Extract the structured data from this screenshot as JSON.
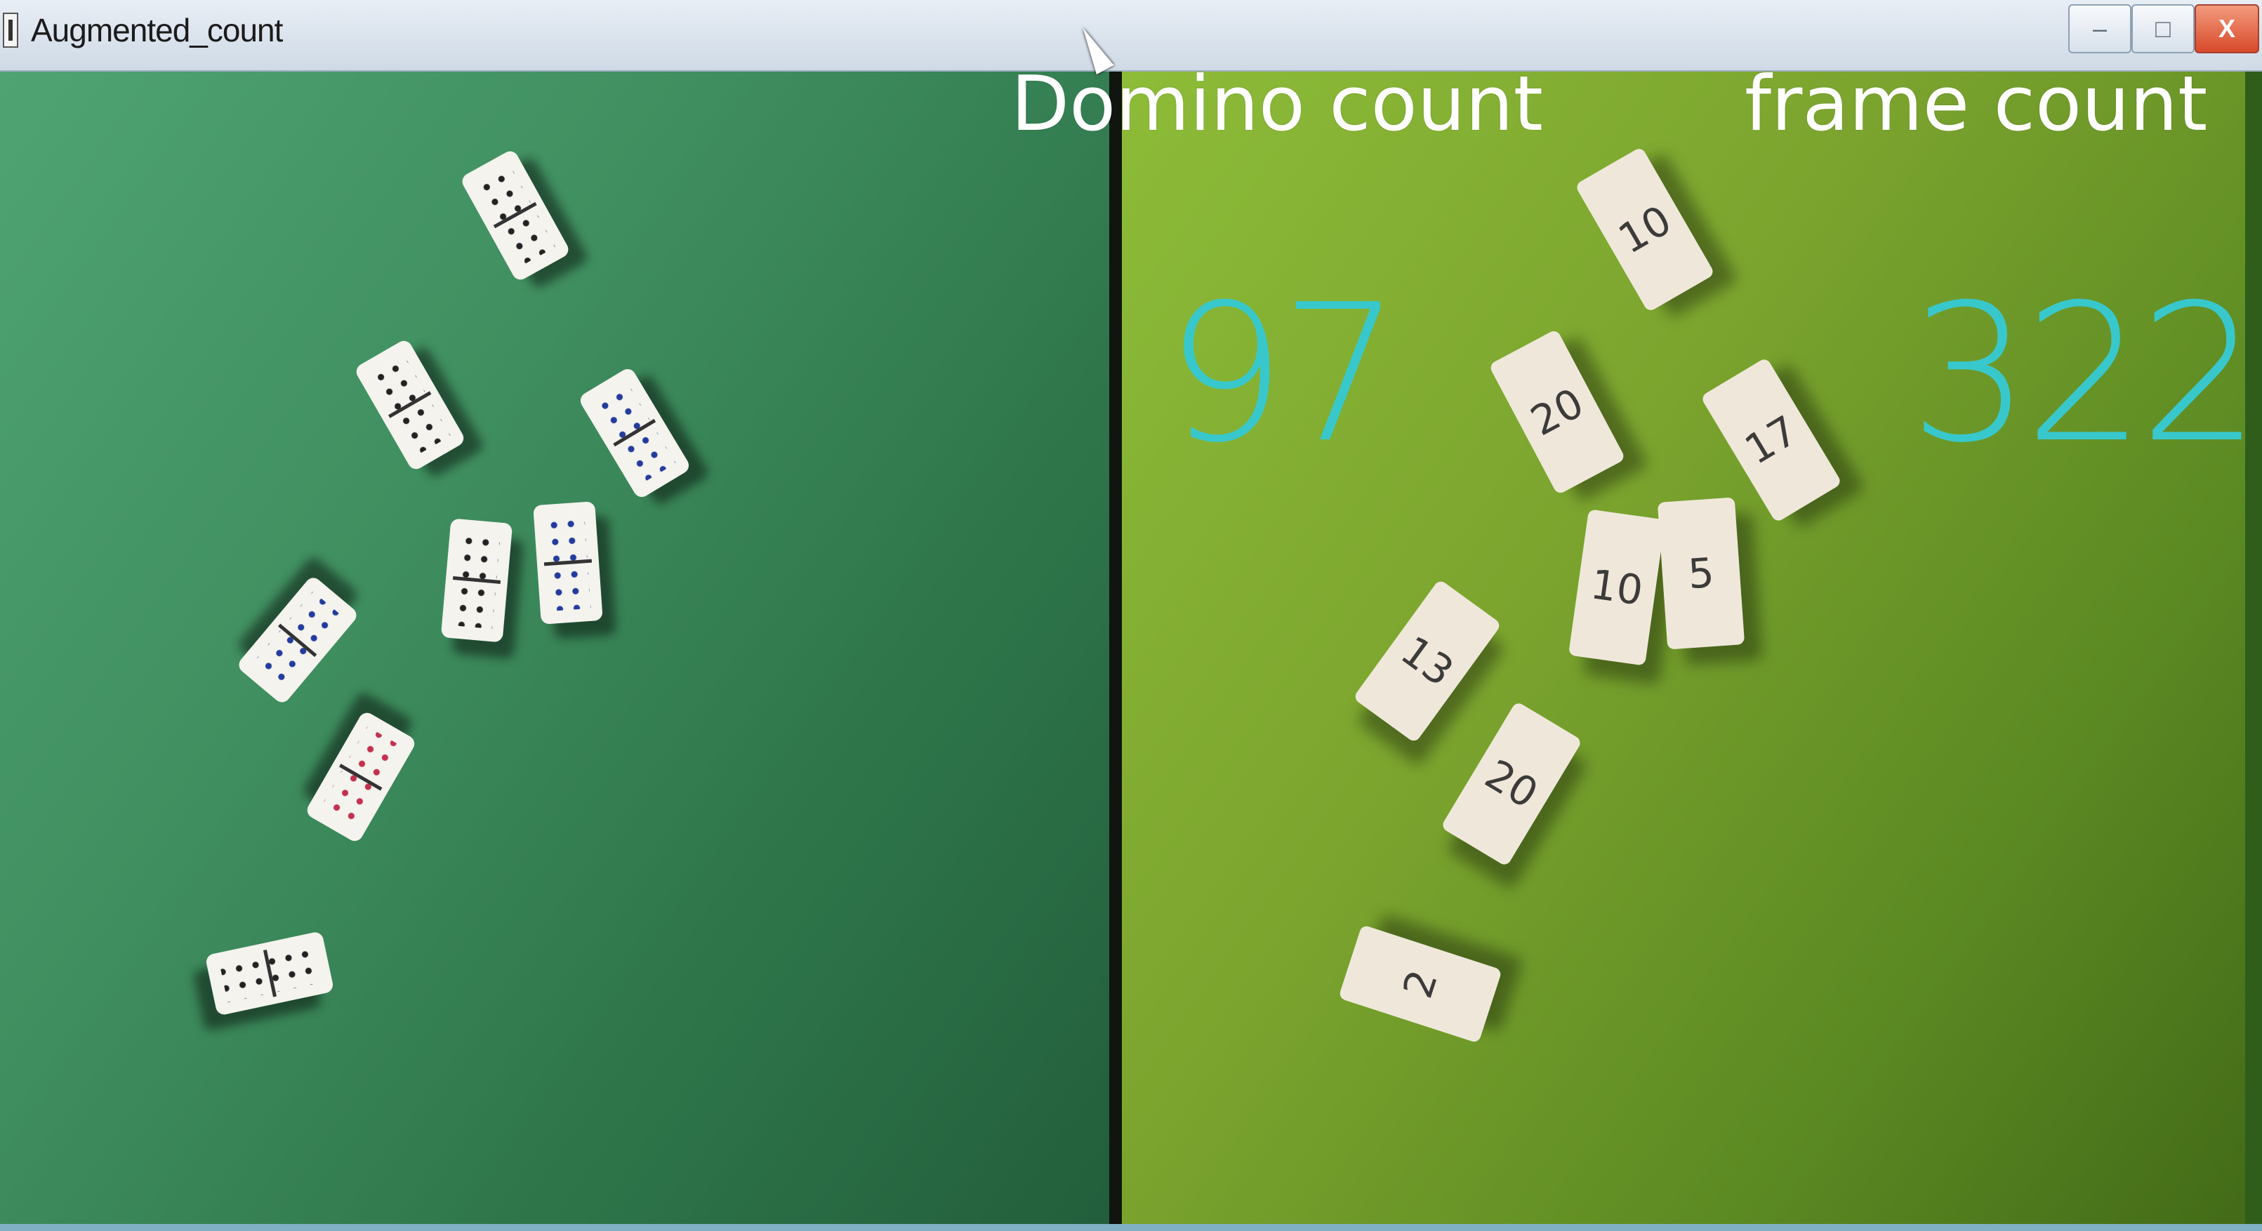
{
  "window": {
    "title": "Augmented_count",
    "buttons": {
      "minimize": "–",
      "maximize": "□",
      "close": "X"
    }
  },
  "overlay": {
    "domino_count_label": "Domino count",
    "frame_count_label": "frame count",
    "domino_count_value": "97",
    "frame_count_value": "322"
  },
  "right_tiles": [
    "10",
    "20",
    "17",
    "10",
    "5",
    "13",
    "20",
    "2"
  ],
  "colors": {
    "left_table": "#3f8e5f",
    "right_table": "#7ba42e",
    "count_text": "#38c8cc",
    "window_close": "#d8492b"
  }
}
